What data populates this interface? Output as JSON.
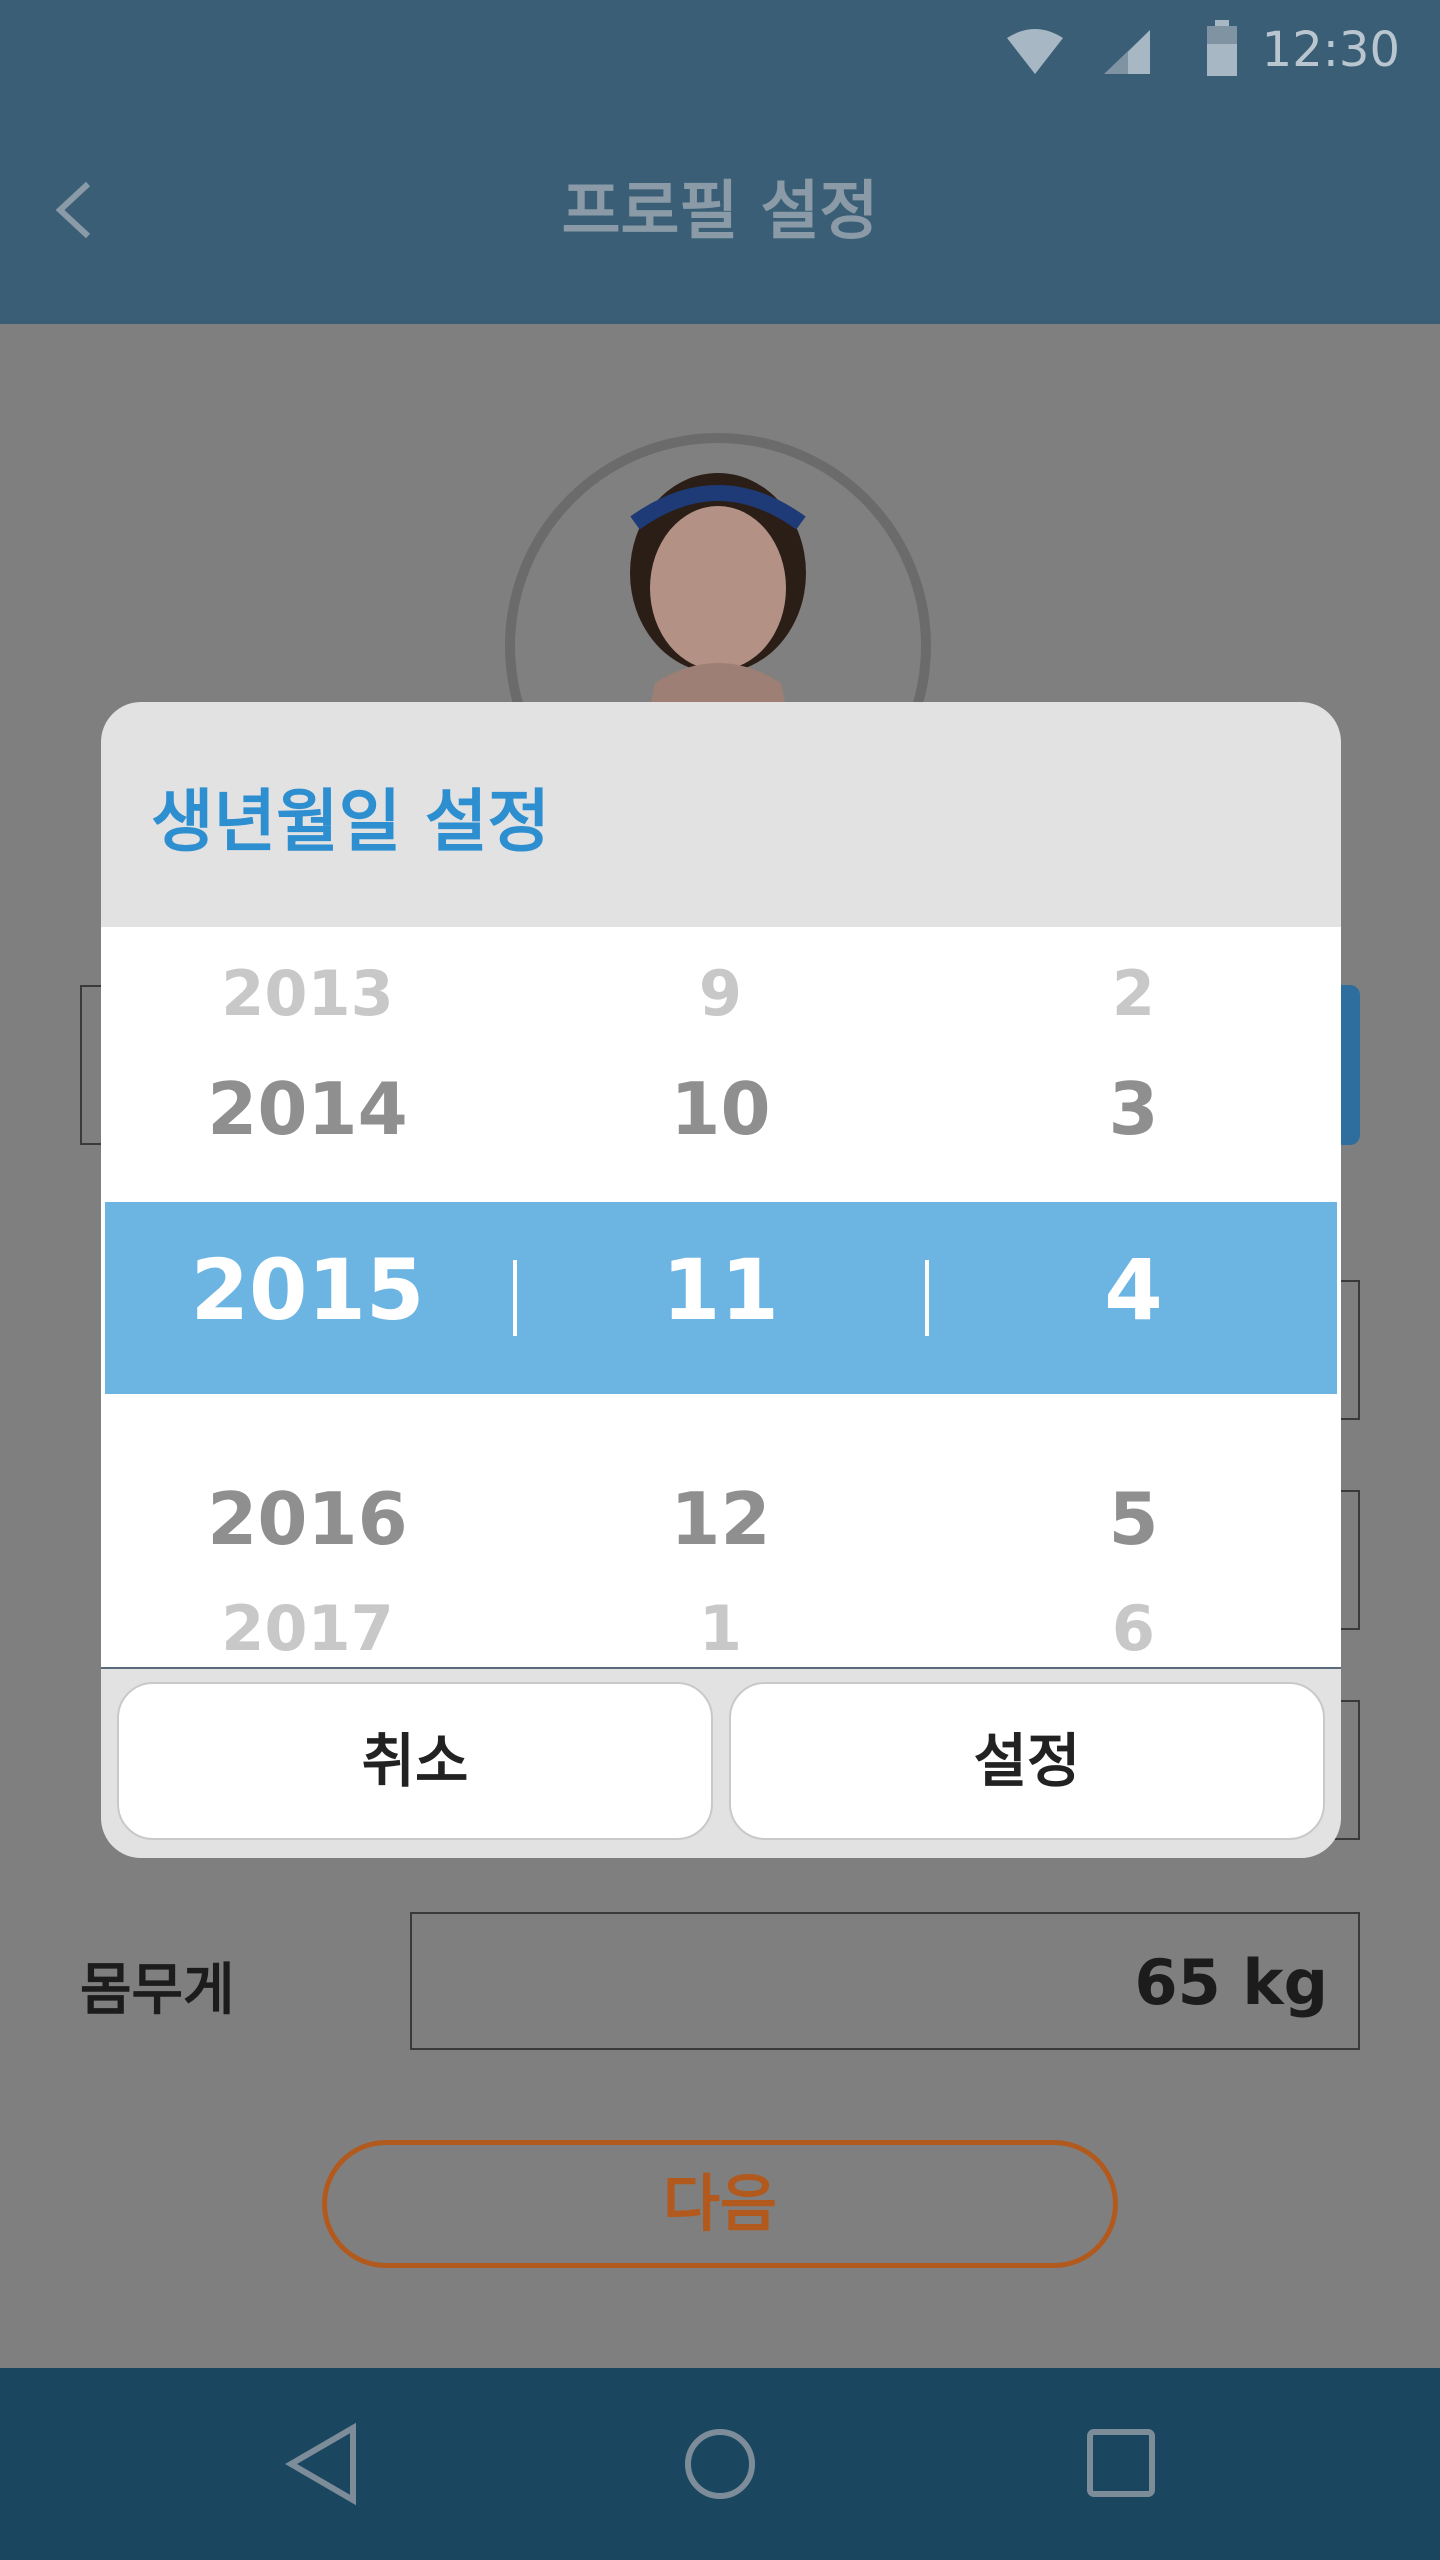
{
  "status_bar": {
    "time": "12:30"
  },
  "app_bar": {
    "title": "프로필 설정"
  },
  "form": {
    "weight_label": "몸무게",
    "weight_value": "65 kg",
    "next_label": "다음"
  },
  "dialog": {
    "title": "생년월일 설정",
    "years": [
      "2013",
      "2014",
      "2015",
      "2016",
      "2017"
    ],
    "months": [
      "9",
      "10",
      "11",
      "12",
      "1"
    ],
    "days": [
      "2",
      "3",
      "4",
      "5",
      "6"
    ],
    "selected": {
      "year": "2015",
      "month": "11",
      "day": "4"
    },
    "cancel_label": "취소",
    "confirm_label": "설정"
  },
  "colors": {
    "app_bar": "#3a5e76",
    "dialog_title": "#2e8fd0",
    "picker_highlight": "#6cb5e3",
    "next_button": "#b25a1e",
    "nav_bar": "#1b4660"
  },
  "icons": {
    "back": "chevron-left-icon",
    "nav_back": "triangle-back-icon",
    "nav_home": "circle-home-icon",
    "nav_recents": "square-recents-icon",
    "wifi": "wifi-icon",
    "signal": "signal-icon",
    "battery": "battery-icon"
  }
}
